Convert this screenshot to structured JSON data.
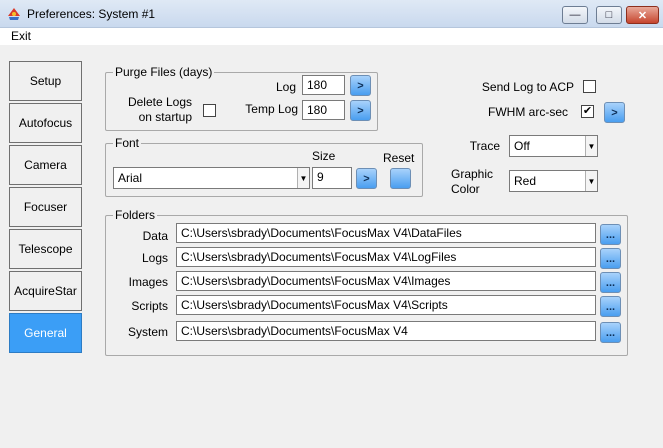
{
  "window": {
    "title": "Preferences: System #1"
  },
  "menu": {
    "exit": "Exit"
  },
  "tabs": [
    {
      "label": "Setup"
    },
    {
      "label": "Autofocus"
    },
    {
      "label": "Camera"
    },
    {
      "label": "Focuser"
    },
    {
      "label": "Telescope"
    },
    {
      "label": "AcquireStar"
    },
    {
      "label": "General"
    }
  ],
  "purge": {
    "title": "Purge Files (days)",
    "log_label": "Log",
    "log_value": "180",
    "temp_label": "Temp Log",
    "temp_value": "180",
    "delete_label_1": "Delete Logs",
    "delete_label_2": "on startup",
    "delete_checked": false
  },
  "right": {
    "send_log_label": "Send Log to ACP",
    "send_log_checked": false,
    "fwhm_label": "FWHM arc-sec",
    "fwhm_checked": true,
    "trace_label": "Trace",
    "trace_value": "Off",
    "graphic_label_1": "Graphic",
    "graphic_label_2": "Color",
    "graphic_value": "Red"
  },
  "font": {
    "title": "Font",
    "size_label": "Size",
    "reset_label": "Reset",
    "name": "Arial",
    "size": "9"
  },
  "folders": {
    "title": "Folders",
    "rows": [
      {
        "label": "Data",
        "path": "C:\\Users\\sbrady\\Documents\\FocusMax V4\\DataFiles"
      },
      {
        "label": "Logs",
        "path": "C:\\Users\\sbrady\\Documents\\FocusMax V4\\LogFiles"
      },
      {
        "label": "Images",
        "path": "C:\\Users\\sbrady\\Documents\\FocusMax V4\\Images"
      },
      {
        "label": "Scripts",
        "path": "C:\\Users\\sbrady\\Documents\\FocusMax V4\\Scripts"
      },
      {
        "label": "System",
        "path": "C:\\Users\\sbrady\\Documents\\FocusMax V4"
      }
    ],
    "browse_label": "..."
  },
  "icons": {
    "arrow_button": ">",
    "check_mark": "✔"
  },
  "colors": {
    "active_tab": "#3b9ef6",
    "blue_button": "#4a9ef0"
  }
}
